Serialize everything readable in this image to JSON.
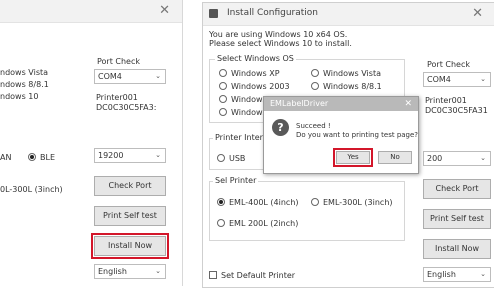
{
  "left_window": {
    "os_options": [
      "ndows Vista",
      "ndows 8/8.1",
      "ndows 10"
    ],
    "port_check_label": "Port Check",
    "port_value": "COM4",
    "printer_info_line1": "Printer001",
    "printer_info_line2": "DC0C30C5FA3:",
    "interface_options": [
      "AN",
      "BLE"
    ],
    "baud_value": "19200",
    "model_partial": "0L-300L (3inch)",
    "check_port_label": "Check Port",
    "print_self_test_label": "Print Self test",
    "install_now_label": "Install Now",
    "language_value": "English"
  },
  "right_window": {
    "title": "Install Configuration",
    "info_line1": "You are using Windows 10 x64 OS.",
    "info_line2": "Please select Windows 10 to install.",
    "select_os_label": "Select Windows OS",
    "os_options": [
      "Windows XP",
      "Windows Vista",
      "Windows 2003",
      "Windows 8/8.1",
      "Windows",
      "Windows"
    ],
    "port_check_label": "Port Check",
    "port_value": "COM4",
    "printer_info_line1": "Printer001",
    "printer_info_line2": "DC0C30C5FA31",
    "printer_interface_label": "Printer Interfac",
    "interface_usb": "USB",
    "baud_value": "200",
    "select_printer_label": "Sel Printer",
    "model_options": [
      "EML-400L (4inch)",
      "EML-300L (3inch)",
      "EML 200L (2inch)"
    ],
    "check_port_label": "Check Port",
    "print_self_test_label": "Print Self test",
    "install_now_label": "Install Now",
    "set_default_label": "Set Default Printer",
    "language_value": "English"
  },
  "dialog": {
    "title": "EMLabelDriver",
    "message_line1": "Succeed !",
    "message_line2": "Do you want to printing test page?",
    "yes_label": "Yes",
    "no_label": "No"
  },
  "colors": {
    "highlight": "#d3162a"
  }
}
